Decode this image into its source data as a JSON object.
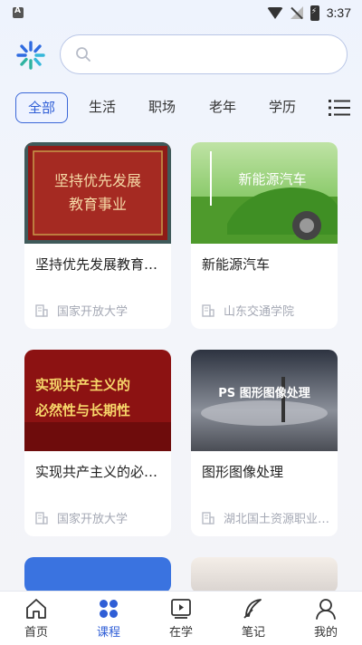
{
  "status_bar": {
    "time": "3:37",
    "app_badge": "A"
  },
  "search": {
    "placeholder": ""
  },
  "tabs": [
    {
      "label": "全部",
      "active": true
    },
    {
      "label": "生活",
      "active": false
    },
    {
      "label": "职场",
      "active": false
    },
    {
      "label": "老年",
      "active": false
    },
    {
      "label": "学历",
      "active": false
    }
  ],
  "courses": [
    {
      "title": "坚持优先发展教育事业",
      "org": "国家开放大学",
      "img_text": [
        "坚持优先发展",
        "教育事业"
      ]
    },
    {
      "title": "新能源汽车",
      "org": "山东交通学院",
      "img_text": [
        "新能源汽车"
      ]
    },
    {
      "title": "实现共产主义的必然性与长期性",
      "org": "国家开放大学",
      "img_text": [
        "实现共产主义的",
        "必然性与长期性"
      ]
    },
    {
      "title": "图形图像处理",
      "org": "湖北国土资源职业学院",
      "img_text": [
        "PS 图形图像处理"
      ]
    }
  ],
  "bottom_nav": [
    {
      "label": "首页",
      "icon": "home-icon",
      "active": false
    },
    {
      "label": "课程",
      "icon": "grid-icon",
      "active": true
    },
    {
      "label": "在学",
      "icon": "video-icon",
      "active": false
    },
    {
      "label": "笔记",
      "icon": "feather-icon",
      "active": false
    },
    {
      "label": "我的",
      "icon": "user-icon",
      "active": false
    }
  ],
  "colors": {
    "accent": "#2f5ed6",
    "muted": "#a4a8b4"
  }
}
